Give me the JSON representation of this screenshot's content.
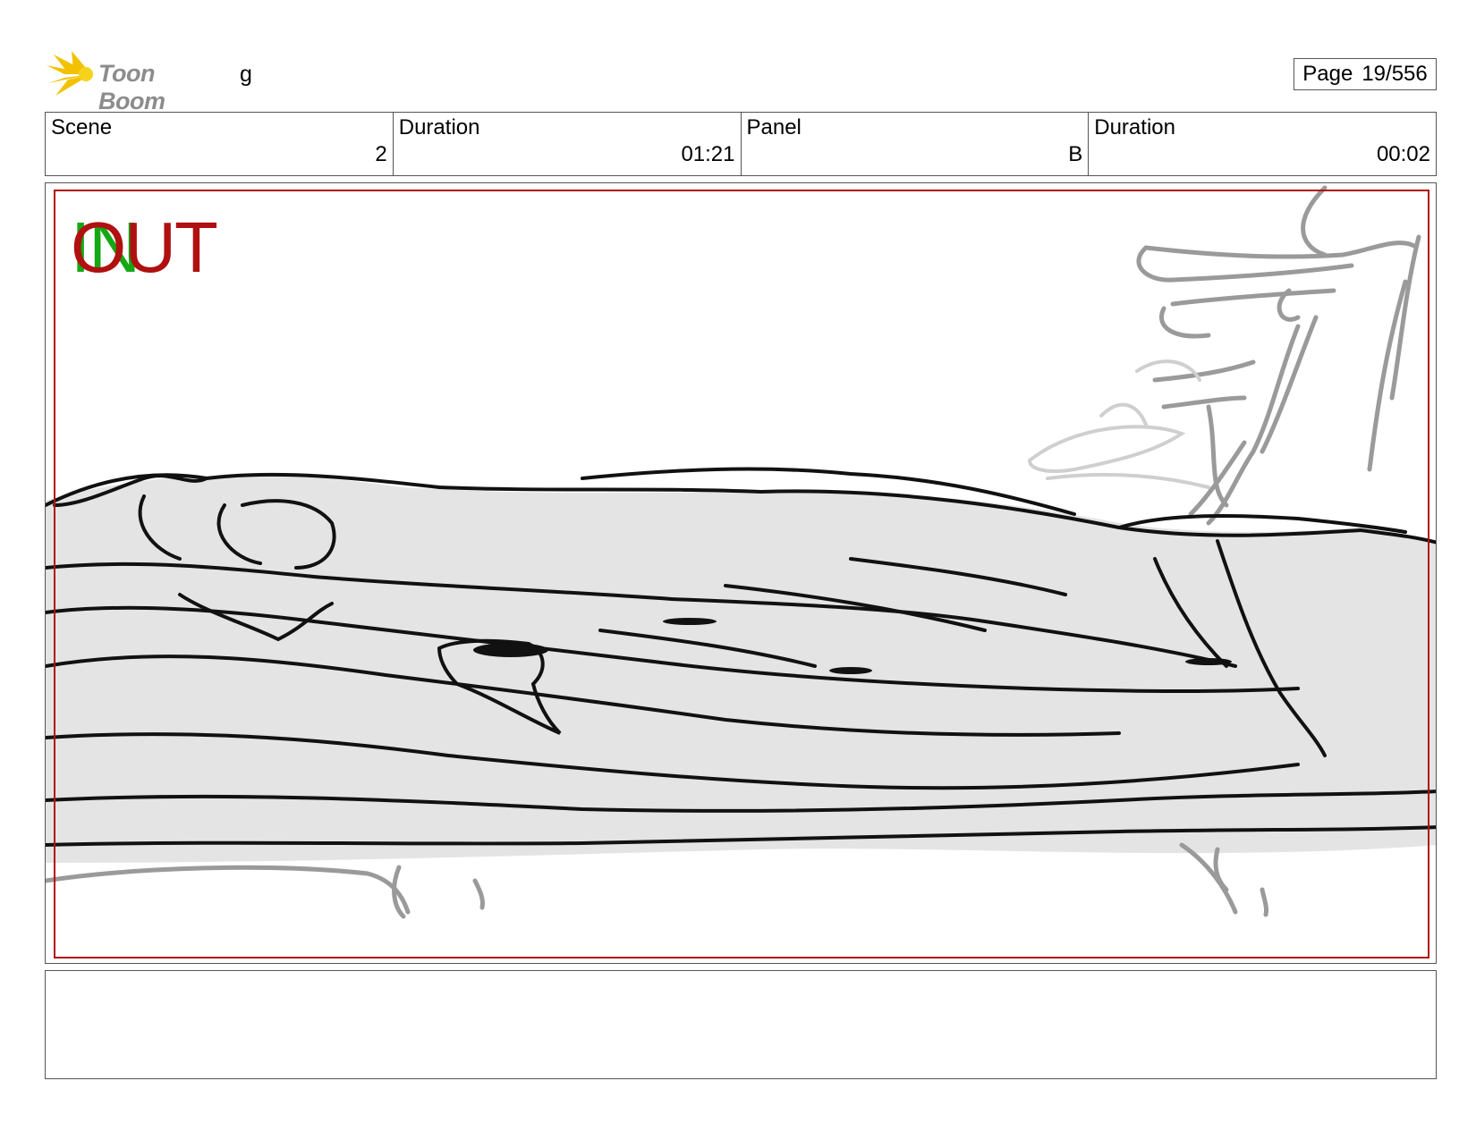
{
  "header": {
    "logo_text": "Toon Boom",
    "project_name": "g",
    "page_label": "Page",
    "page_value": "19/556"
  },
  "info": {
    "scene_label": "Scene",
    "scene_value": "2",
    "scene_duration_label": "Duration",
    "scene_duration_value": "01:21",
    "panel_label": "Panel",
    "panel_value": "B",
    "panel_duration_label": "Duration",
    "panel_duration_value": "00:02"
  },
  "panel_markers": {
    "in_label": "IN",
    "out_label": "OUT",
    "in_color": "#14a814",
    "out_color": "#b01010",
    "safe_frame_color": "#b01010"
  },
  "notes": {
    "text": ""
  }
}
